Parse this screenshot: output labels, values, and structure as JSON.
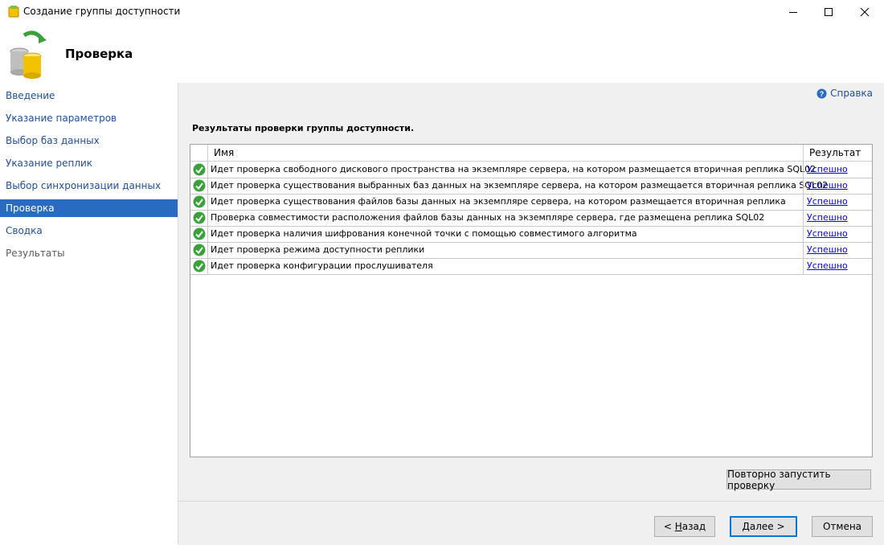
{
  "window": {
    "title": "Создание группы доступности"
  },
  "header": {
    "title": "Проверка"
  },
  "sidebar": {
    "items": [
      {
        "label": "Введение",
        "state": "normal"
      },
      {
        "label": "Указание параметров",
        "state": "normal"
      },
      {
        "label": "Выбор баз данных",
        "state": "normal"
      },
      {
        "label": "Указание реплик",
        "state": "normal"
      },
      {
        "label": "Выбор синхронизации данных",
        "state": "normal"
      },
      {
        "label": "Проверка",
        "state": "active"
      },
      {
        "label": "Сводка",
        "state": "normal"
      },
      {
        "label": "Результаты",
        "state": "disabled"
      }
    ]
  },
  "main": {
    "help_label": "Справка",
    "section_title": "Результаты проверки группы доступности.",
    "columns": {
      "name": "Имя",
      "result": "Результат"
    },
    "rows": [
      {
        "name": "Идет проверка свободного дискового пространства на экземпляре сервера, на котором размещается вторичная реплика SQL02",
        "result": "Успешно"
      },
      {
        "name": "Идет проверка существования выбранных баз данных на экземпляре сервера, на котором размещается вторичная реплика SQL02",
        "result": "Успешно"
      },
      {
        "name": "Идет проверка существования файлов базы данных на экземпляре сервера, на котором размещается вторичная реплика",
        "result": "Успешно"
      },
      {
        "name": "Проверка совместимости расположения файлов базы данных на экземпляре сервера, где размещена реплика SQL02",
        "result": "Успешно"
      },
      {
        "name": "Идет проверка наличия шифрования конечной точки с помощью совместимого алгоритма",
        "result": "Успешно"
      },
      {
        "name": "Идет проверка режима доступности реплики",
        "result": "Успешно"
      },
      {
        "name": "Идет проверка конфигурации прослушивателя",
        "result": "Успешно"
      }
    ],
    "rerun_label": "Повторно запустить проверку"
  },
  "footer": {
    "back_prefix": "< ",
    "back_mnemonic": "Н",
    "back_rest": "азад",
    "next_mnemonic": "Д",
    "next_rest": "алее >",
    "cancel_label": "Отмена"
  },
  "colors": {
    "accent": "#2a6bc2",
    "link": "#1f4f9a",
    "success": "#3aa13a",
    "panel": "#f0f0f0"
  },
  "icons": {
    "status": "success-check-icon",
    "help": "help-icon",
    "app": "database-icon"
  }
}
